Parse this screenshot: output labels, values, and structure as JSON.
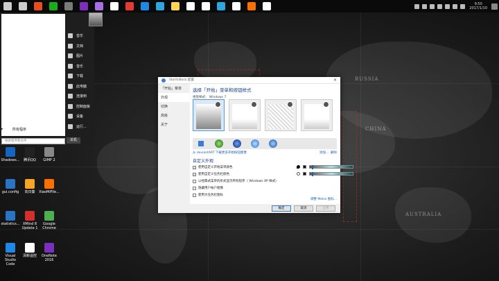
{
  "taskbar": {
    "icon_colors": [
      "#cccccc",
      "#cccccc",
      "#e84e1b",
      "#1aad19",
      "#7a7a7a",
      "#7b2fbf",
      "#a96de5",
      "#ffffff",
      "#e53935",
      "#1e88e5",
      "#2ca5e0",
      "#ffd54f",
      "#ffffff",
      "#ffffff",
      "#2ca5e0",
      "#ffffff",
      "#ff6f00",
      "#ffffff"
    ],
    "time": "9:50",
    "date": "2017/1/10"
  },
  "start_menu": {
    "all_programs": "所有程序",
    "search_placeholder": "搜索程序和文件",
    "items": [
      {
        "label": "音乐",
        "icon": "music-icon"
      },
      {
        "label": "文档",
        "icon": "documents-icon"
      },
      {
        "label": "图片",
        "icon": "pictures-icon"
      },
      {
        "label": "音乐",
        "icon": "music-note-icon"
      },
      {
        "label": "下载",
        "icon": "downloads-icon"
      },
      {
        "label": "此电脑",
        "icon": "computer-icon"
      },
      {
        "label": "连接到",
        "icon": "connect-icon"
      },
      {
        "label": "控制面板",
        "icon": "control-panel-icon"
      },
      {
        "label": "设备",
        "icon": "devices-icon"
      },
      {
        "label": "运行...",
        "icon": "run-icon"
      }
    ],
    "shutdown_label": "关机"
  },
  "desktop_icons": [
    {
      "label": "Shadows...",
      "color": "#1565c0"
    },
    {
      "label": "腾讯QQ",
      "color": "#222222"
    },
    {
      "label": "GIMP 2",
      "color": "#888888"
    },
    {
      "label": "gui.config",
      "color": "#2b73c4"
    },
    {
      "label": "向日葵",
      "color": "#f5a623"
    },
    {
      "label": "XiaoMiFile...",
      "color": "#ff6f00"
    },
    {
      "label": "statistics...",
      "color": "#2b73c4"
    },
    {
      "label": "XMind 8 Update 1",
      "color": "#d32f2f"
    },
    {
      "label": "Google Chrome",
      "color": "#4caf50"
    },
    {
      "label": "Visual Studio Code",
      "color": "#1e88e5"
    },
    {
      "label": "清新遥控",
      "color": "#ffffff"
    },
    {
      "label": "OneNote 2016",
      "color": "#7b2fbf"
    }
  ],
  "map_labels": [
    "RUSSIA",
    "CHINA",
    "AUSTRALIA"
  ],
  "dialog": {
    "title": "StartIsBack 配置",
    "close": "✕",
    "nav": [
      "「开始」菜单",
      "外观",
      "切换",
      "高级",
      "关于"
    ],
    "active_nav": 1,
    "heading": "选择「开始」菜单和按钮样式",
    "visual_style_label": "视觉样式：",
    "visual_style_value": "Windows 7",
    "link_left": "从 deviantART 下载更多开始按钮图像",
    "link_right_1": "添加...",
    "link_right_2": "删除",
    "section_title": "自定义外观",
    "options": [
      {
        "label": "使用自定义开始菜单颜色",
        "checked": true
      },
      {
        "label": "使用自定义任务栏颜色",
        "checked": true
      },
      {
        "label": "以经典式菜单的形式显示所有程序（ Windows XP 样式）",
        "checked": false
      },
      {
        "label": "隐藏用户帐户图像",
        "checked": false
      },
      {
        "label": "使用大任务栏图标",
        "checked": false
      }
    ],
    "tweak_link": "调整 Metro 图标...",
    "buttons": {
      "ok": "确定",
      "cancel": "取消",
      "apply": "应用"
    }
  }
}
